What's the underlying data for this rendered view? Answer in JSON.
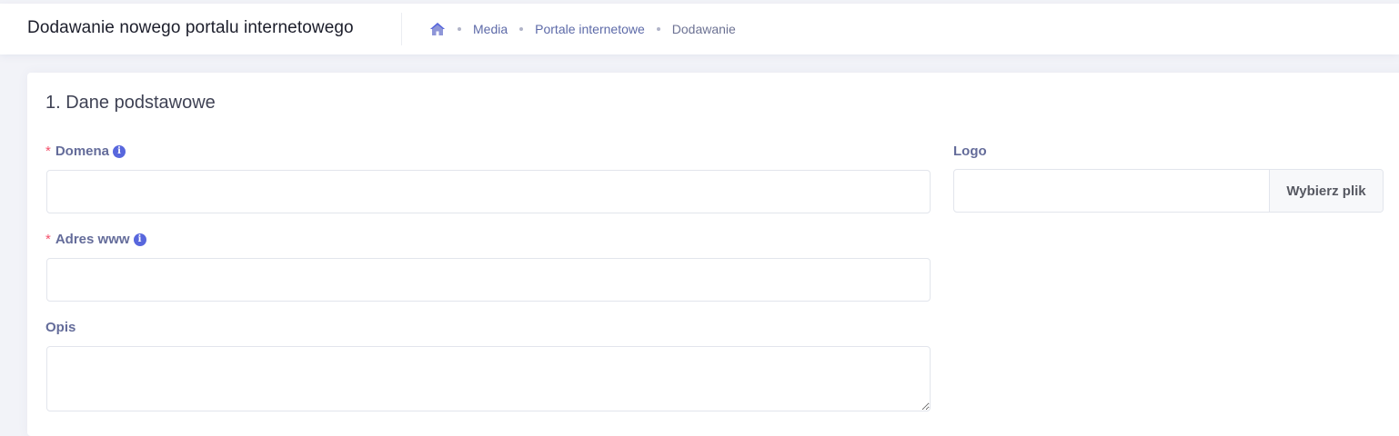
{
  "header": {
    "title": "Dodawanie nowego portalu internetowego",
    "breadcrumb": {
      "home_icon": "home-icon",
      "items": [
        "Media",
        "Portale internetowe"
      ],
      "current": "Dodawanie"
    }
  },
  "form": {
    "section_title": "1. Dane podstawowe",
    "required_mark": "*",
    "info_glyph": "i",
    "domain": {
      "label": "Domena",
      "value": "",
      "placeholder": ""
    },
    "url": {
      "label": "Adres www",
      "value": "",
      "placeholder": ""
    },
    "description": {
      "label": "Opis",
      "value": "",
      "placeholder": ""
    },
    "logo": {
      "label": "Logo",
      "value": "",
      "button_label": "Wybierz plik"
    }
  },
  "colors": {
    "accent": "#5867dd",
    "required": "#f4516c",
    "label": "#646c9a",
    "background": "#f2f3f8"
  }
}
